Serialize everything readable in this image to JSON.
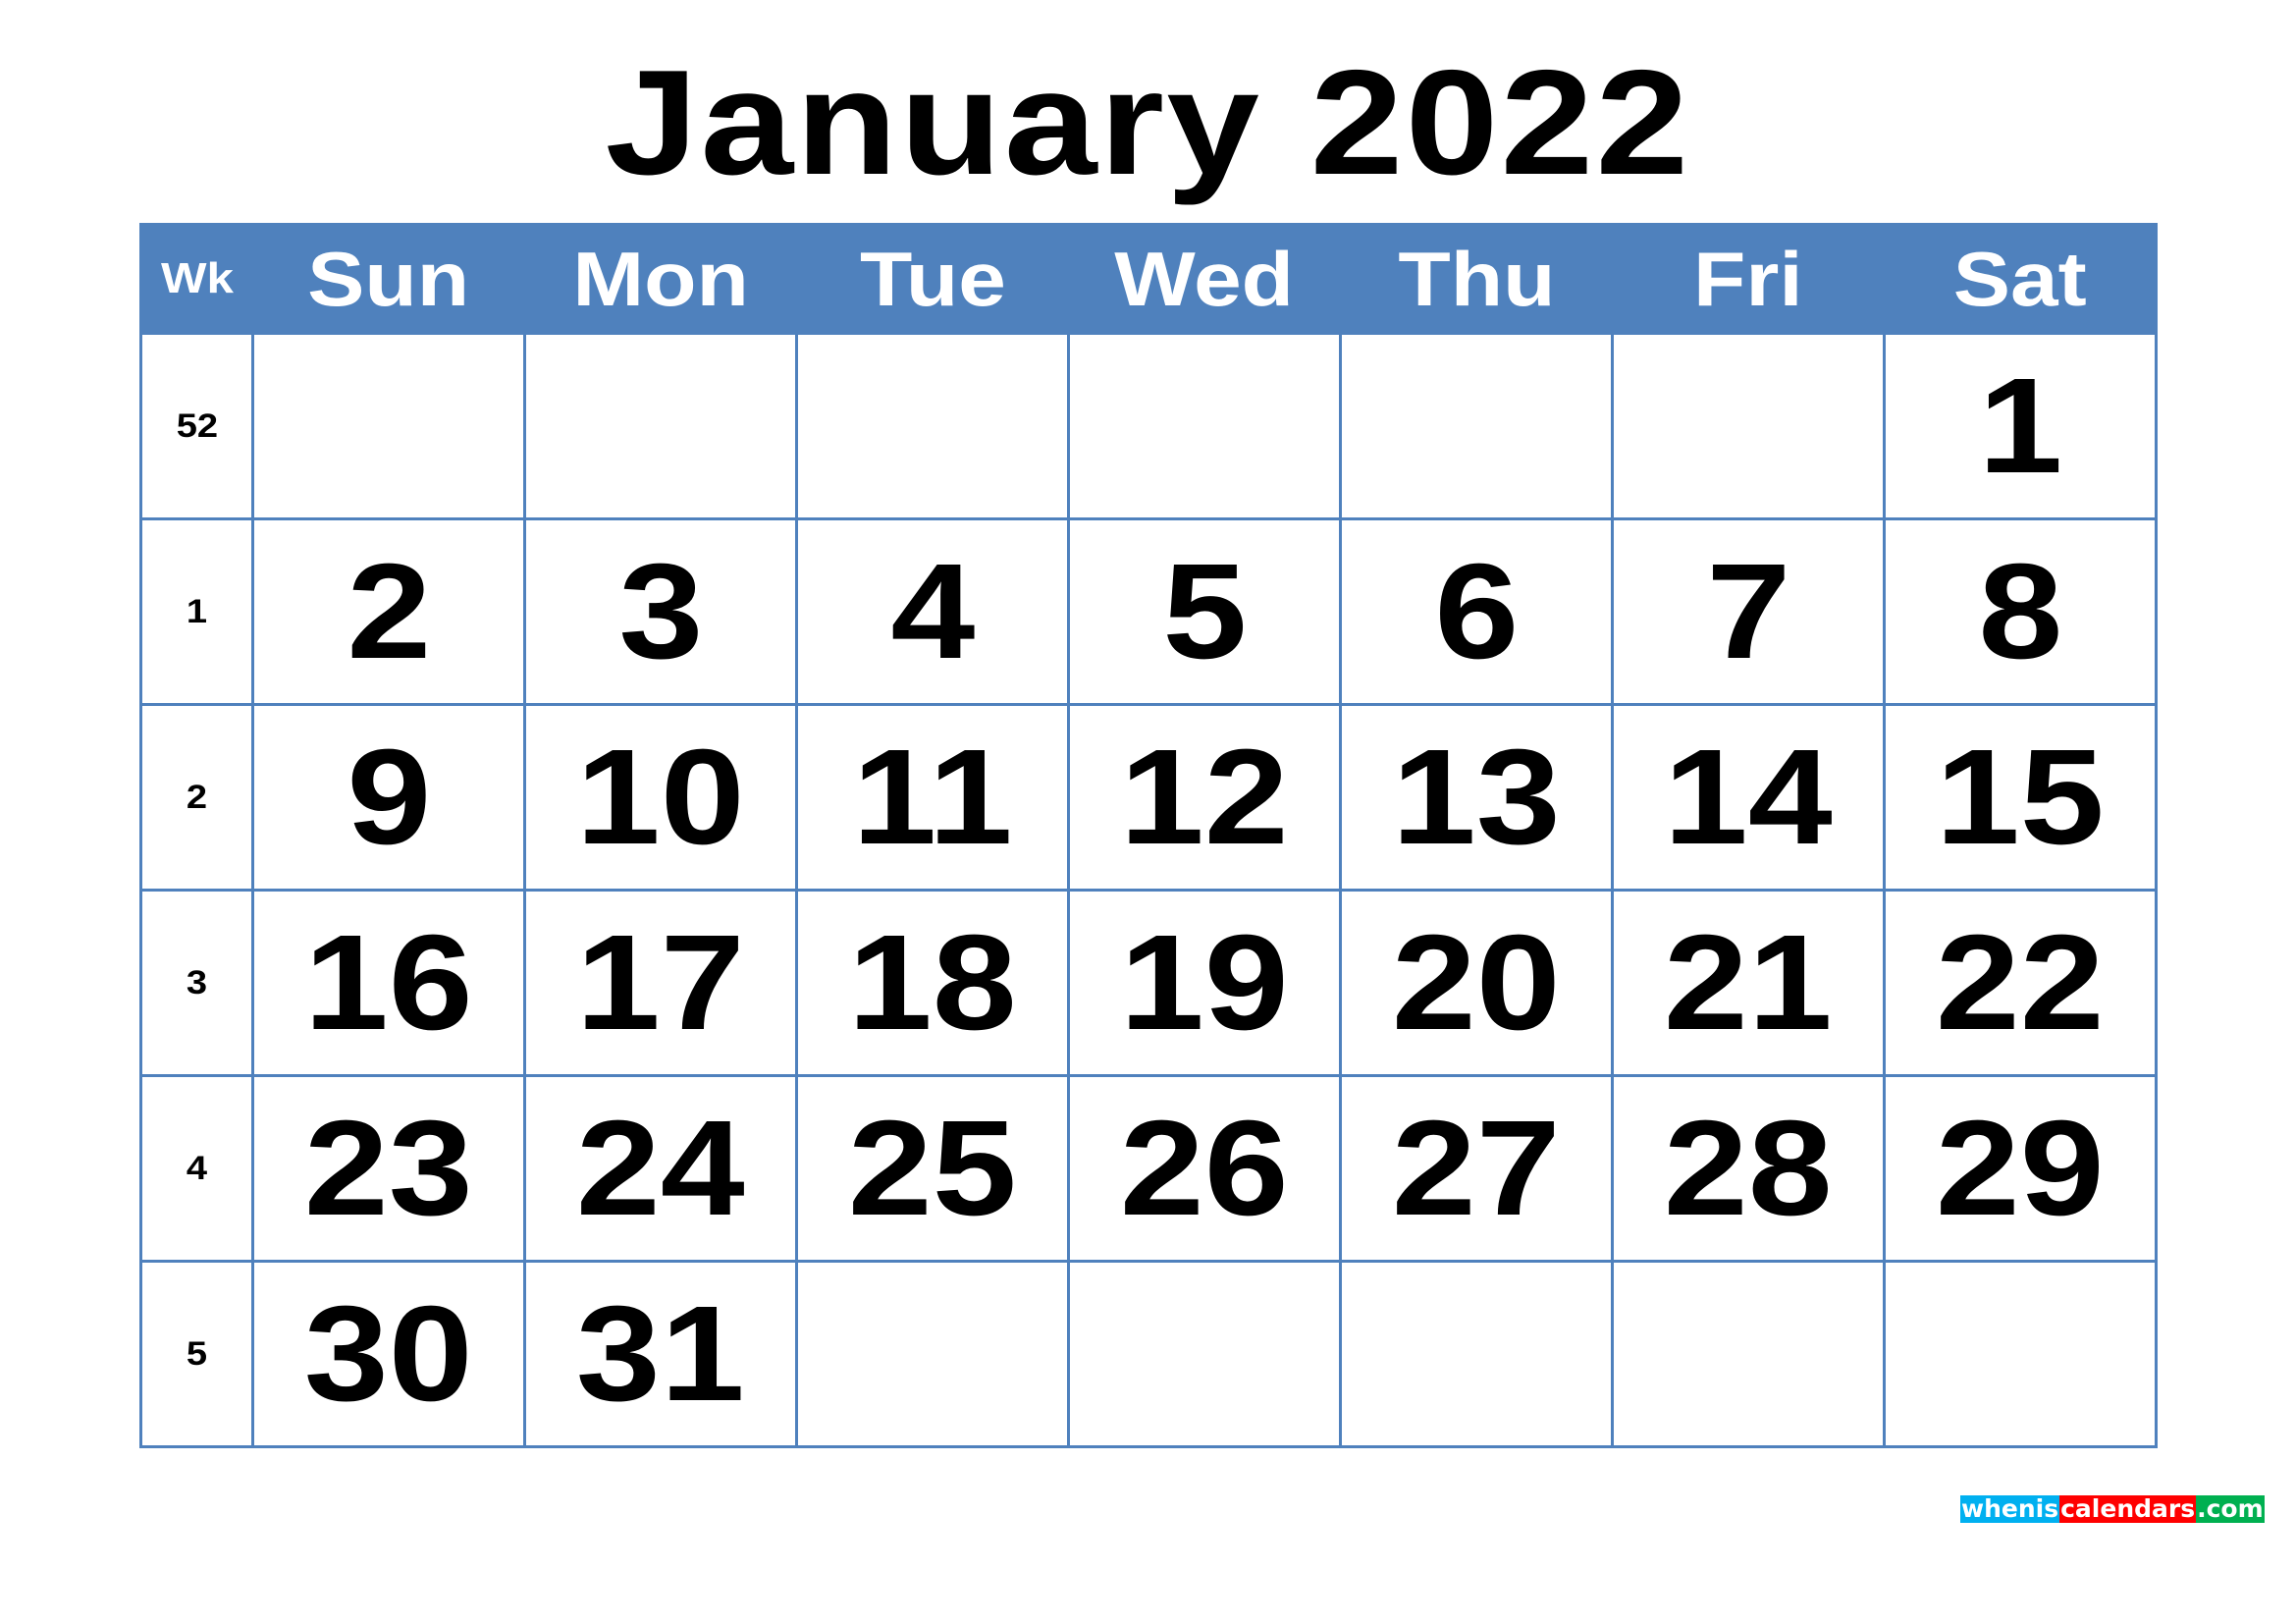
{
  "title": "January 2022",
  "header": {
    "wk": "Wk",
    "days": [
      "Sun",
      "Mon",
      "Tue",
      "Wed",
      "Thu",
      "Fri",
      "Sat"
    ]
  },
  "colors": {
    "grid": "#4f81bd",
    "header_bg": "#4f81bd"
  },
  "weeks": [
    {
      "wk": "52",
      "days": [
        "",
        "",
        "",
        "",
        "",
        "",
        "1"
      ]
    },
    {
      "wk": "1",
      "days": [
        "2",
        "3",
        "4",
        "5",
        "6",
        "7",
        "8"
      ]
    },
    {
      "wk": "2",
      "days": [
        "9",
        "10",
        "11",
        "12",
        "13",
        "14",
        "15"
      ]
    },
    {
      "wk": "3",
      "days": [
        "16",
        "17",
        "18",
        "19",
        "20",
        "21",
        "22"
      ]
    },
    {
      "wk": "4",
      "days": [
        "23",
        "24",
        "25",
        "26",
        "27",
        "28",
        "29"
      ]
    },
    {
      "wk": "5",
      "days": [
        "30",
        "31",
        "",
        "",
        "",
        "",
        ""
      ]
    }
  ],
  "logo": {
    "part1": "whenis",
    "part2": "calendars",
    "part3": ".com"
  }
}
